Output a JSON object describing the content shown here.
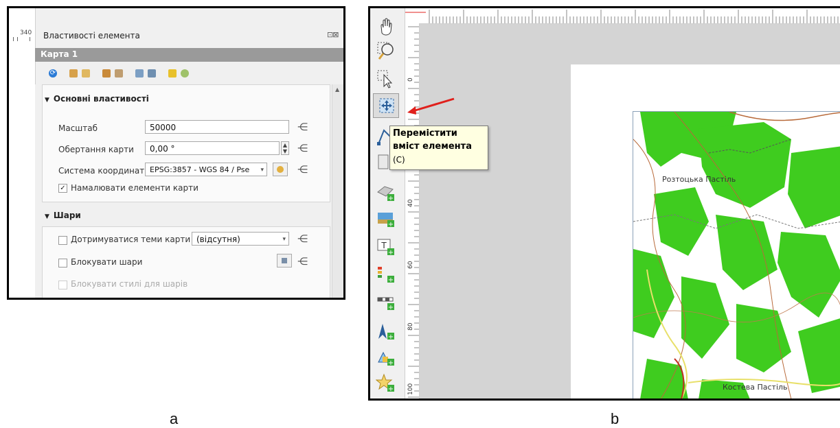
{
  "panel_a": {
    "ruler_value": "340",
    "title": "Властивості елемента",
    "float_buttons": "⊡⊠",
    "item_name": "Карта 1",
    "main_group": {
      "title": "Основні властивості",
      "scale_label": "Масштаб",
      "scale_value": "50000",
      "rotation_label": "Обертання карти",
      "rotation_value": "0,00 °",
      "crs_label": "Система координат",
      "crs_value": "EPSG:3857 - WGS 84 / Pse",
      "draw_items_label": "Намалювати елементи карти",
      "draw_items_checked": true
    },
    "layers_group": {
      "title": "Шари",
      "follow_theme_label": "Дотримуватися теми карти",
      "follow_theme_value": "(відсутня)",
      "lock_layers_label": "Блокувати шари",
      "lock_styles_label": "Блокувати стилі для шарів"
    }
  },
  "panel_b": {
    "tooltip": {
      "line1": "Перемістити",
      "line2": "вміст елемента",
      "line3": "(C)"
    },
    "ruler_labels": [
      "0",
      "40",
      "60",
      "80",
      "100"
    ],
    "map_labels": [
      "Розтоцька Пастіль",
      "Костева Пастіль"
    ]
  },
  "captions": {
    "a": "a",
    "b": "b"
  },
  "colors": {
    "forest": "#3fcc1f",
    "arrow": "#e0201c",
    "tooltip_bg": "#ffffe1",
    "item_bar": "#9a9a9a"
  }
}
